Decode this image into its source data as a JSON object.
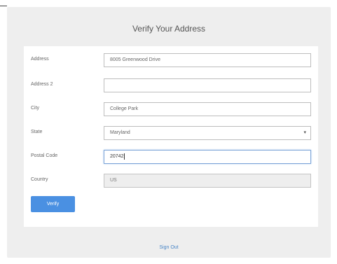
{
  "page": {
    "title": "Verify Your Address"
  },
  "form": {
    "address": {
      "label": "Address",
      "value": "8005 Greenwood Drive",
      "placeholder": ""
    },
    "address2": {
      "label": "Address 2",
      "value": "",
      "placeholder": ""
    },
    "city": {
      "label": "City",
      "value": "College Park",
      "placeholder": ""
    },
    "state": {
      "label": "State",
      "value": "Maryland",
      "icon": "chevron-down-icon"
    },
    "postal_code": {
      "label": "Postal Code",
      "value": "20742"
    },
    "country": {
      "label": "Country",
      "value": "US"
    },
    "verify_label": "Verify"
  },
  "footer": {
    "signout_label": "Sign Out"
  },
  "colors": {
    "accent": "#4a90e2",
    "panel_bg": "#eeeeee",
    "link": "#4a86c7"
  }
}
